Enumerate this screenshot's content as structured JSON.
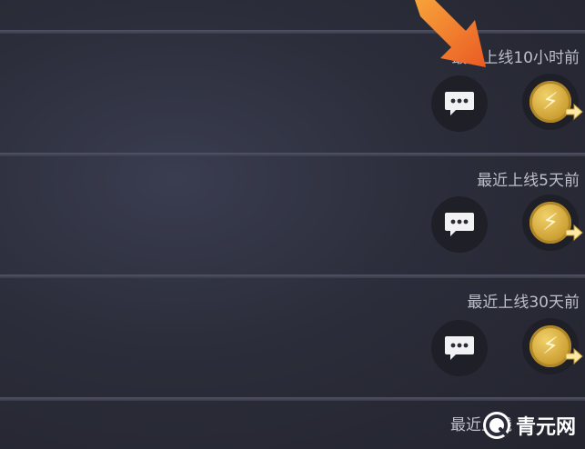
{
  "list": {
    "rows": [
      {
        "status": "最近上线10小时前"
      },
      {
        "status": "最近上线5天前"
      },
      {
        "status": "最近上线30天前"
      },
      {
        "status": "最近上线"
      }
    ]
  },
  "icons": {
    "chat": "chat-bubble-icon",
    "gift": "lightning-coin-send-icon",
    "annotation": "orange-arrow-icon"
  },
  "colors": {
    "background": "#2b2d3a",
    "divider": "#4a4c5c",
    "status_text": "#bdbfc9",
    "coin": "#d9b040",
    "arrow": "#f06a2a"
  },
  "watermark": {
    "text": "青元网"
  }
}
